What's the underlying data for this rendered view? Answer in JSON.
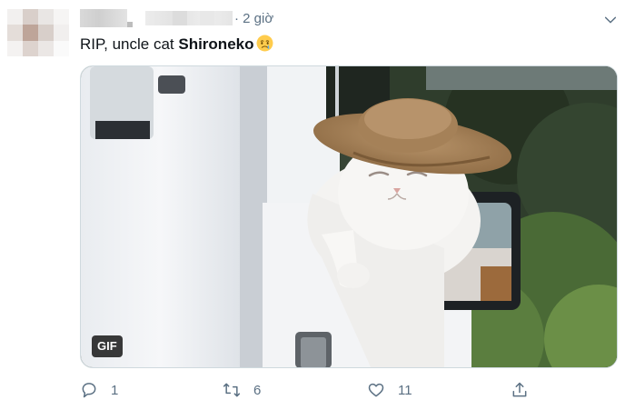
{
  "header": {
    "timestamp": "· 2 giờ"
  },
  "tweet": {
    "text_prefix": "RIP, uncle cat ",
    "text_bold": "Shironeko",
    "emoji": "crying-face-emoji"
  },
  "media": {
    "badge": "GIF"
  },
  "actions": {
    "reply_count": "1",
    "retweet_count": "6",
    "like_count": "11"
  },
  "colors": {
    "secondary_text": "#5b7083",
    "primary_text": "#0f1419",
    "icon": "#5b7083"
  },
  "icons": [
    "chevron-down-icon",
    "reply-icon",
    "retweet-icon",
    "like-icon",
    "share-icon"
  ]
}
